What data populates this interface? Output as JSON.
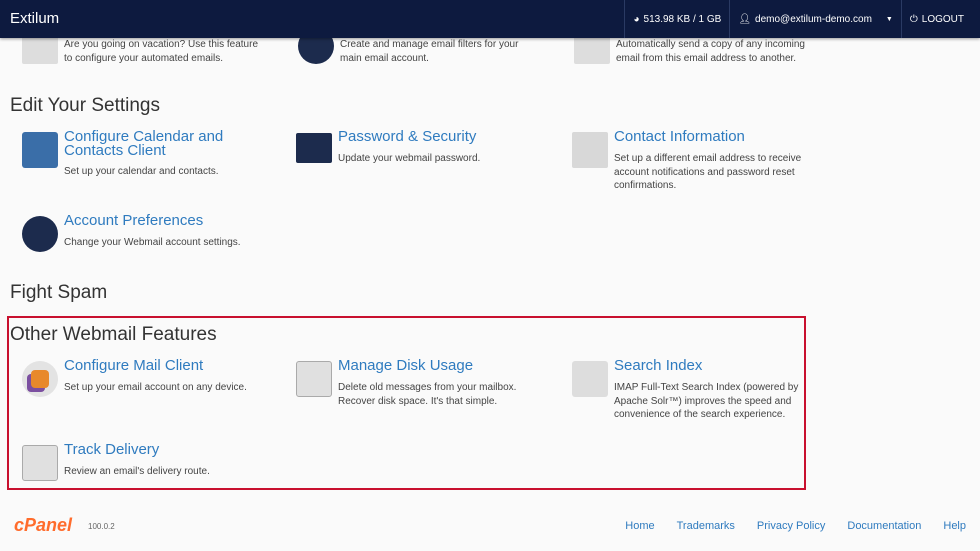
{
  "header": {
    "brand": "Extilum",
    "disk_usage": "513.98 KB / 1 GB",
    "user": "demo@extilum-demo.com",
    "logout": "LOGOUT"
  },
  "partial_row": [
    {
      "desc": "Are you going on vacation? Use this feature to configure your automated emails."
    },
    {
      "desc": "Create and manage email filters for your main email account."
    },
    {
      "desc": "Automatically send a copy of any incoming email from this email address to another."
    }
  ],
  "edit_settings": {
    "title": "Edit Your Settings",
    "items": [
      {
        "title": "Configure Calendar and Contacts Client",
        "desc": "Set up your calendar and contacts."
      },
      {
        "title": "Password & Security",
        "desc": "Update your webmail password."
      },
      {
        "title": "Contact Information",
        "desc": "Set up a different email address to receive account notifications and password reset confirmations."
      },
      {
        "title": "Account Preferences",
        "desc": "Change your Webmail account settings."
      }
    ]
  },
  "fight_spam": {
    "title": "Fight Spam"
  },
  "other_features": {
    "title": "Other Webmail Features",
    "items": [
      {
        "title": "Configure Mail Client",
        "desc": "Set up your email account on any device."
      },
      {
        "title": "Manage Disk Usage",
        "desc": "Delete old messages from your mailbox. Recover disk space. It's that simple."
      },
      {
        "title": "Search Index",
        "desc": "IMAP Full-Text Search Index (powered by Apache Solr™) improves the speed and convenience of the search experience."
      },
      {
        "title": "Track Delivery",
        "desc": "Review an email's delivery route."
      }
    ]
  },
  "footer": {
    "logo": "cPanel",
    "version": "100.0.2",
    "links": [
      "Home",
      "Trademarks",
      "Privacy Policy",
      "Documentation",
      "Help"
    ]
  },
  "colors": {
    "header": "#0d1a3f",
    "link": "#2f7bbf",
    "highlight_box": "#c8102e",
    "logo": "#ff6c2c"
  }
}
